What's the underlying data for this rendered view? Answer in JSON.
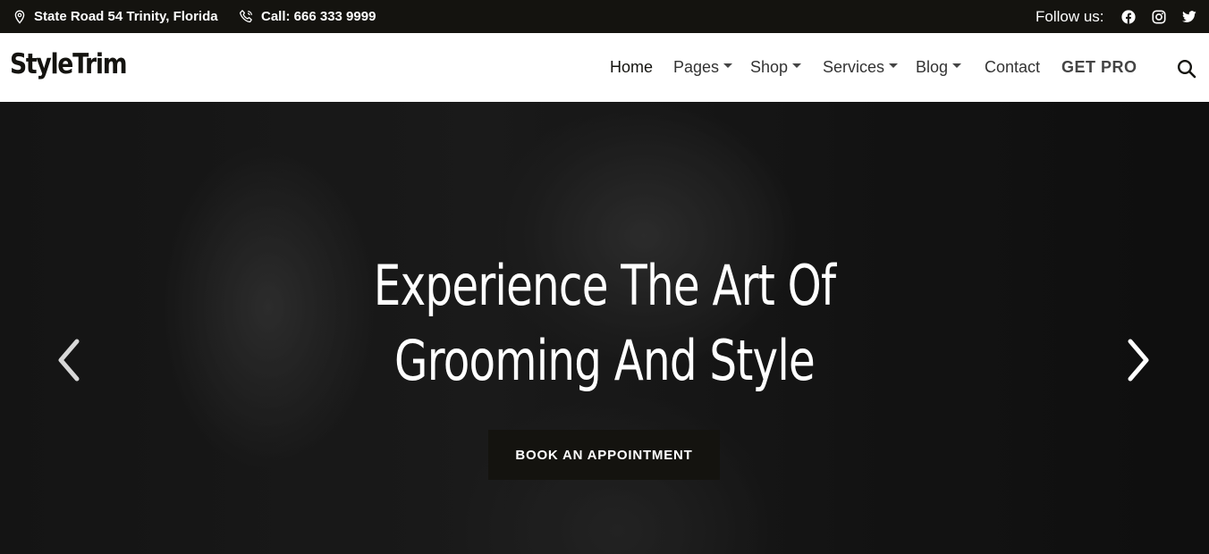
{
  "topbar": {
    "address": "State Road 54 Trinity, Florida",
    "phone": "Call: 666 333 9999",
    "follow_label": "Follow us:",
    "social_icons": [
      "facebook-icon",
      "instagram-icon",
      "twitter-icon"
    ]
  },
  "header": {
    "logo": "StyleTrim",
    "nav": [
      {
        "label": "Home",
        "dropdown": false
      },
      {
        "label": "Pages",
        "dropdown": true
      },
      {
        "label": "Shop",
        "dropdown": true
      },
      {
        "label": "Services",
        "dropdown": true
      },
      {
        "label": "Blog",
        "dropdown": true
      },
      {
        "label": "Contact",
        "dropdown": false
      },
      {
        "label": "GET PRO",
        "dropdown": false
      }
    ],
    "search_icon": "search-icon"
  },
  "hero": {
    "title_line1": "Experience The Art Of",
    "title_line2": "Grooming And Style",
    "cta_label": "BOOK AN APPOINTMENT",
    "prev_icon": "chevron-left-icon",
    "next_icon": "chevron-right-icon"
  },
  "colors": {
    "dark": "#14130f",
    "text_white": "#ffffff",
    "nav_text": "#333333"
  }
}
